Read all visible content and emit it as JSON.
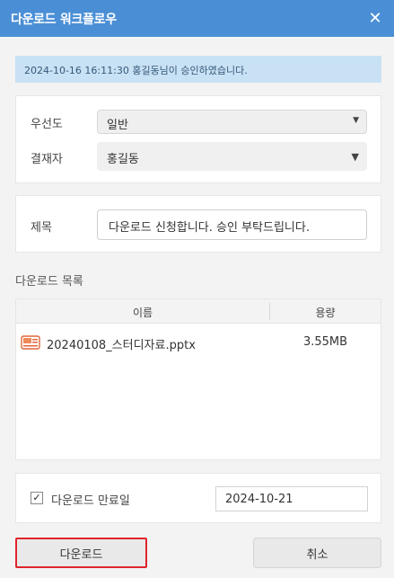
{
  "dialog": {
    "title": "다운로드 워크플로우",
    "close_icon": "close-icon"
  },
  "notice": {
    "text": "2024-10-16 16:11:30 홍길동님이 승인하였습니다."
  },
  "form": {
    "priority_label": "우선도",
    "priority_value": "일반",
    "approver_label": "결재자",
    "approver_value": "홍길동",
    "subject_label": "제목",
    "subject_value": "다운로드 신청합니다. 승인 부탁드립니다."
  },
  "download_list": {
    "title": "다운로드 목록",
    "columns": [
      "이름",
      "용량"
    ],
    "files": [
      {
        "name": "20240108_스터디자료.pptx",
        "size": "3.55MB",
        "icon": "pptx-file-icon"
      }
    ]
  },
  "expiry": {
    "checked": true,
    "label": "다운로드 만료일",
    "date": "2024-10-21"
  },
  "buttons": {
    "download": "다운로드",
    "cancel": "취소"
  },
  "colors": {
    "titlebar": "#4a8fd6",
    "notice_bg": "#c9e1f4",
    "highlight": "#e0242b"
  }
}
